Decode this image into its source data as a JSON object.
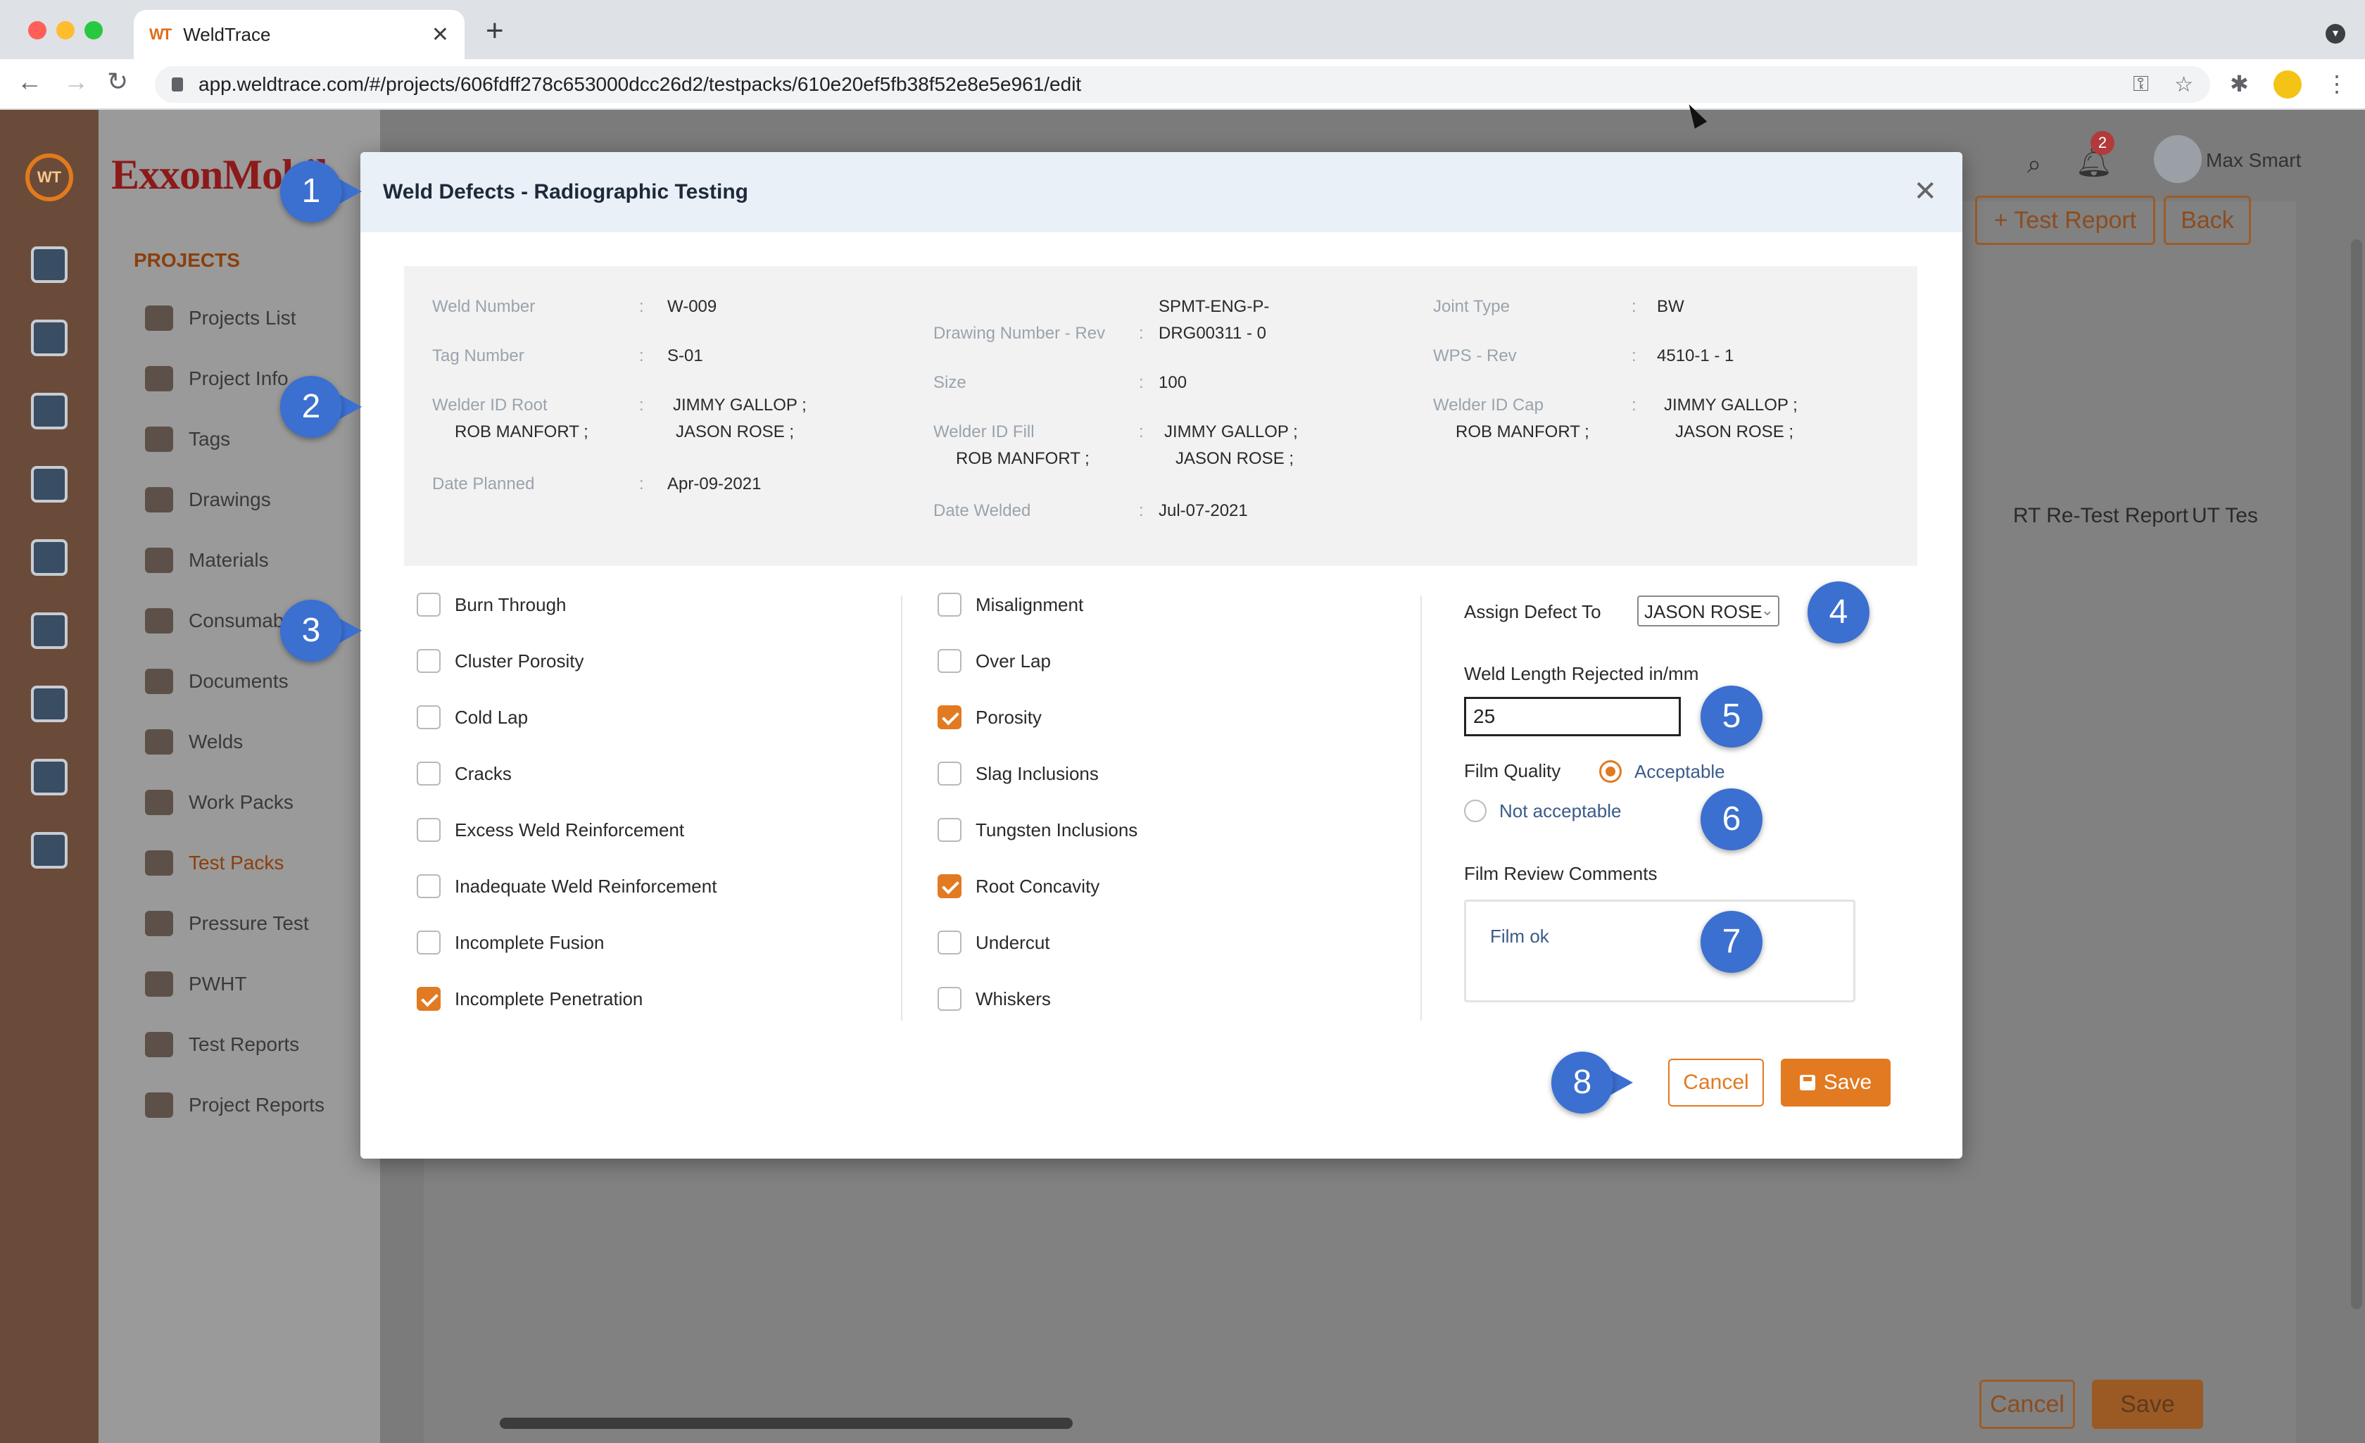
{
  "browser": {
    "tab_title": "WeldTrace",
    "tab_favicon": "WT",
    "url": "app.weldtrace.com/#/projects/606fdff278c653000dcc26d2/testpacks/610e20ef5fb38f52e8e5e961/edit"
  },
  "app": {
    "brand": "ExxonMobil",
    "notification_count": "2",
    "user_name": "Max Smart",
    "sidebar": {
      "heading": "PROJECTS",
      "items": [
        {
          "label": "Projects List"
        },
        {
          "label": "Project Info"
        },
        {
          "label": "Tags"
        },
        {
          "label": "Drawings"
        },
        {
          "label": "Materials"
        },
        {
          "label": "Consumables"
        },
        {
          "label": "Documents"
        },
        {
          "label": "Welds"
        },
        {
          "label": "Work Packs"
        },
        {
          "label": "Test Packs"
        },
        {
          "label": "Pressure Test"
        },
        {
          "label": "PWHT"
        },
        {
          "label": "Test Reports"
        },
        {
          "label": "Project Reports"
        }
      ]
    },
    "background": {
      "test_report_button": "+ Test Report",
      "back_button": "Back",
      "col_rt_retest": "RT Re-Test Report",
      "col_ut_test": "UT Tes",
      "cancel_button": "Cancel",
      "save_button": "Save"
    }
  },
  "modal": {
    "title": "Weld Defects - Radiographic Testing",
    "info": {
      "weld_number": {
        "label": "Weld Number",
        "value": "W-009"
      },
      "tag_number": {
        "label": "Tag Number",
        "value": "S-01"
      },
      "welder_id_root": {
        "label": "Welder ID Root",
        "value_1": "JIMMY GALLOP ;",
        "value_2": "ROB MANFORT ;",
        "value_3": "JASON ROSE ;"
      },
      "date_planned": {
        "label": "Date Planned",
        "value": "Apr-09-2021"
      },
      "drawing_number": {
        "label": "Drawing Number - Rev",
        "value_1": "SPMT-ENG-P-",
        "value_2": "DRG00311 - 0"
      },
      "size": {
        "label": "Size",
        "value": "100"
      },
      "welder_id_fill": {
        "label": "Welder ID Fill",
        "value_1": "JIMMY GALLOP ;",
        "value_2": "ROB MANFORT ;",
        "value_3": "JASON ROSE ;"
      },
      "date_welded": {
        "label": "Date Welded",
        "value": "Jul-07-2021"
      },
      "joint_type": {
        "label": "Joint Type",
        "value": "BW"
      },
      "wps_rev": {
        "label": "WPS - Rev",
        "value": "4510-1 - 1"
      },
      "welder_id_cap": {
        "label": "Welder ID Cap",
        "value_1": "JIMMY GALLOP ;",
        "value_2": "ROB MANFORT ;",
        "value_3": "JASON ROSE ;"
      }
    },
    "defects_col1": [
      {
        "label": "Burn Through",
        "checked": false
      },
      {
        "label": "Cluster Porosity",
        "checked": false
      },
      {
        "label": "Cold Lap",
        "checked": false
      },
      {
        "label": "Cracks",
        "checked": false
      },
      {
        "label": "Excess Weld Reinforcement",
        "checked": false
      },
      {
        "label": "Inadequate Weld Reinforcement",
        "checked": false
      },
      {
        "label": "Incomplete Fusion",
        "checked": false
      },
      {
        "label": "Incomplete Penetration",
        "checked": true
      }
    ],
    "defects_col2": [
      {
        "label": "Misalignment",
        "checked": false
      },
      {
        "label": "Over Lap",
        "checked": false
      },
      {
        "label": "Porosity",
        "checked": true
      },
      {
        "label": "Slag Inclusions",
        "checked": false
      },
      {
        "label": "Tungsten Inclusions",
        "checked": false
      },
      {
        "label": "Root Concavity",
        "checked": true
      },
      {
        "label": "Undercut",
        "checked": false
      },
      {
        "label": "Whiskers",
        "checked": false
      }
    ],
    "assign_defect_label": "Assign Defect To",
    "assign_defect_value": "JASON ROSE",
    "weld_length_label": "Weld Length Rejected in/mm",
    "weld_length_value": "25",
    "film_quality_label": "Film Quality",
    "film_quality_options": [
      {
        "label": "Acceptable",
        "selected": true
      },
      {
        "label": "Not acceptable",
        "selected": false
      }
    ],
    "film_comments_label": "Film Review Comments",
    "film_comments_value": "Film ok",
    "cancel_label": "Cancel",
    "save_label": "Save"
  },
  "markers": [
    "1",
    "2",
    "3",
    "4",
    "5",
    "6",
    "7",
    "8"
  ],
  "colors": {
    "accent": "#e17a21",
    "marker": "#3b6fd0",
    "header_bg": "#e9f0f8"
  }
}
